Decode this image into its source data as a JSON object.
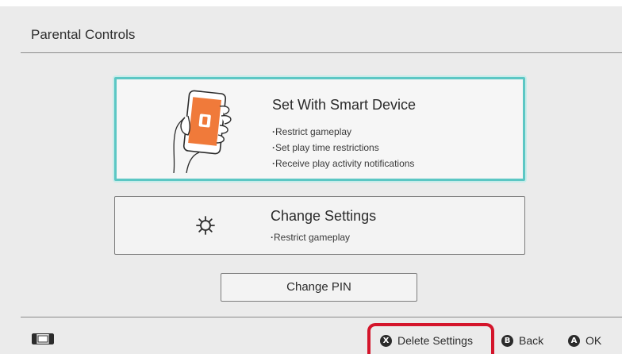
{
  "header": {
    "title": "Parental Controls"
  },
  "smart_device": {
    "title": "Set With Smart Device",
    "bullets": [
      "Restrict gameplay",
      "Set play time restrictions",
      "Receive play activity notifications"
    ],
    "icon": "phone-in-hand-icon",
    "accent": "#5cc7c4",
    "app_color": "#f07a3a"
  },
  "change_settings": {
    "title": "Change Settings",
    "bullet": "Restrict gameplay",
    "icon": "gear-icon"
  },
  "pin": {
    "label": "Change PIN"
  },
  "footer": {
    "console_icon": "console-icon",
    "actions": [
      {
        "glyph": "X",
        "label": "Delete Settings"
      },
      {
        "glyph": "B",
        "label": "Back"
      },
      {
        "glyph": "A",
        "label": "OK"
      }
    ],
    "highlight_color": "#d4152b"
  }
}
